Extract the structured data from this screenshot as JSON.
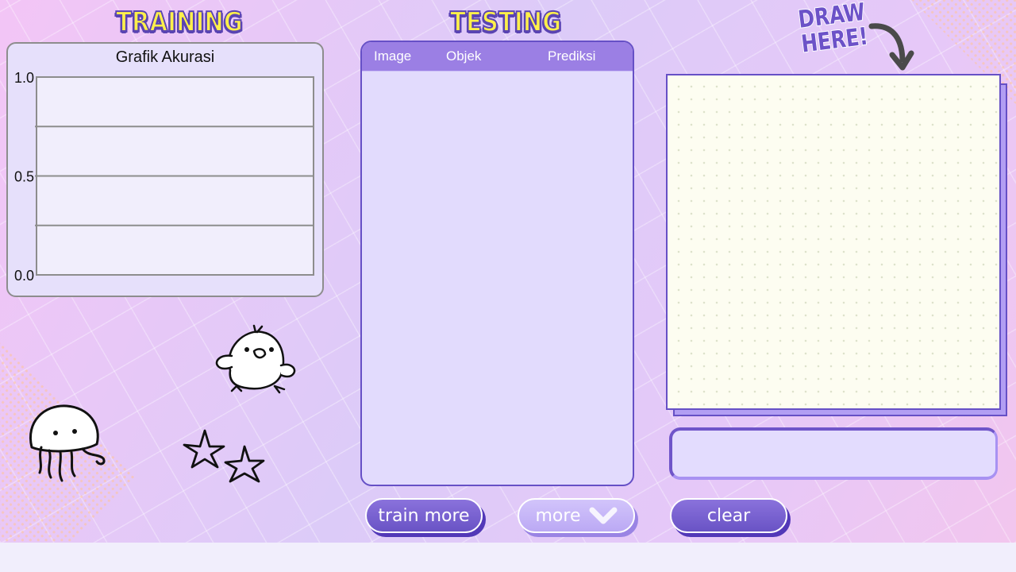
{
  "headings": {
    "training": "TRAINING",
    "testing": "TESTING",
    "draw_here_line1": "DRAW",
    "draw_here_line2": "HERE!"
  },
  "chart_data": {
    "type": "line",
    "title": "Grafik Akurasi",
    "xlabel": "",
    "ylabel": "",
    "ylim": [
      0.0,
      1.0
    ],
    "ytick_labels": [
      "1.0",
      "0.5",
      "0.0"
    ],
    "yticks": [
      1.0,
      0.5,
      0.0
    ],
    "grid_values": [
      0.75,
      0.5,
      0.25
    ],
    "grid": true,
    "series": []
  },
  "table": {
    "columns": [
      "Image",
      "Objek",
      "Prediksi"
    ],
    "rows": []
  },
  "result": {
    "text": ""
  },
  "buttons": {
    "train_more": "train more",
    "more": "more",
    "clear": "clear"
  },
  "icons": {
    "draw_arrow": "curved-arrow-icon",
    "more_chevron": "chevron-down-icon",
    "doodles": [
      "chick-doodle",
      "jellyfish-doodle",
      "star-doodle"
    ]
  },
  "colors": {
    "accent": "#6650c6",
    "heading_yellow": "#fff04a",
    "table_header": "#9b7fe4",
    "canvas_bg": "#fdfdf1"
  }
}
